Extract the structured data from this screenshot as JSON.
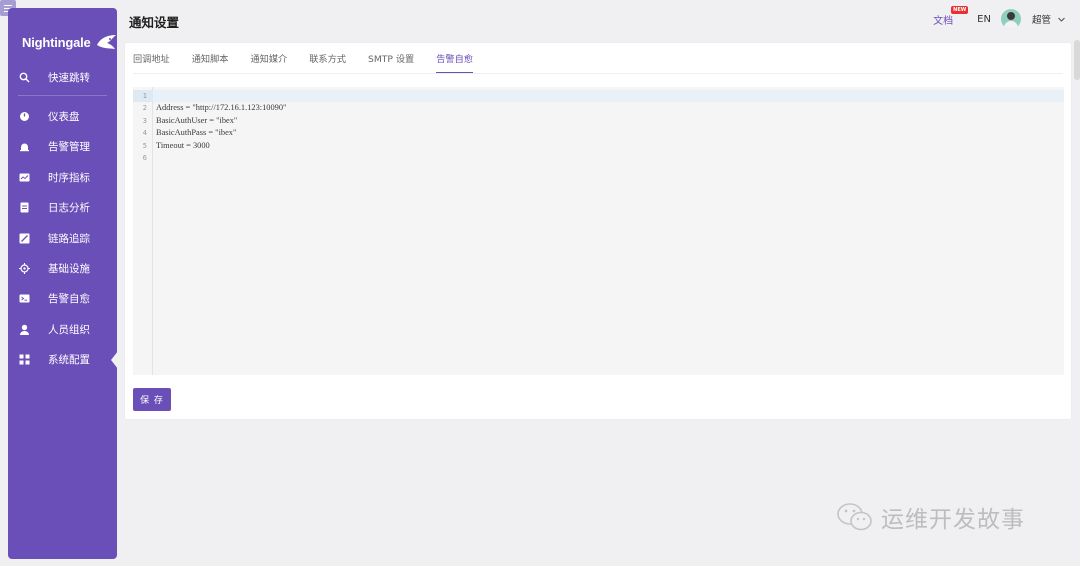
{
  "app": {
    "brand": "Nightingale",
    "page_title": "通知设置"
  },
  "header": {
    "doc_link": "文档",
    "new_badge": "NEW",
    "lang": "EN",
    "username": "超管"
  },
  "sidebar": {
    "items": [
      {
        "label": "快速跳转",
        "icon": "search-icon"
      },
      {
        "label": "仪表盘",
        "icon": "dashboard-icon"
      },
      {
        "label": "告警管理",
        "icon": "alarm-bell-icon"
      },
      {
        "label": "时序指标",
        "icon": "chart-icon"
      },
      {
        "label": "日志分析",
        "icon": "log-icon"
      },
      {
        "label": "链路追踪",
        "icon": "trace-icon"
      },
      {
        "label": "基础设施",
        "icon": "infrastructure-icon"
      },
      {
        "label": "告警自愈",
        "icon": "terminal-icon"
      },
      {
        "label": "人员组织",
        "icon": "user-icon"
      },
      {
        "label": "系统配置",
        "icon": "grid-icon",
        "active": true
      }
    ]
  },
  "tabs": [
    {
      "label": "回调地址"
    },
    {
      "label": "通知脚本"
    },
    {
      "label": "通知媒介"
    },
    {
      "label": "联系方式"
    },
    {
      "label": "SMTP 设置"
    },
    {
      "label": "告警自愈",
      "active": true
    }
  ],
  "editor": {
    "lines": [
      {
        "num": "1",
        "text": ""
      },
      {
        "num": "2",
        "text": "Address = \"http://172.16.1.123:10090\""
      },
      {
        "num": "3",
        "text": "BasicAuthUser = \"ibex\""
      },
      {
        "num": "4",
        "text": "BasicAuthPass = \"ibex\""
      },
      {
        "num": "5",
        "text": "Timeout = 3000"
      },
      {
        "num": "6",
        "text": ""
      }
    ]
  },
  "actions": {
    "save_label": "保 存"
  },
  "watermark": {
    "text": "运维开发故事"
  },
  "colors": {
    "brand": "#6b4fb8",
    "badge": "#e63232",
    "page_bg": "#f0f0f2"
  }
}
